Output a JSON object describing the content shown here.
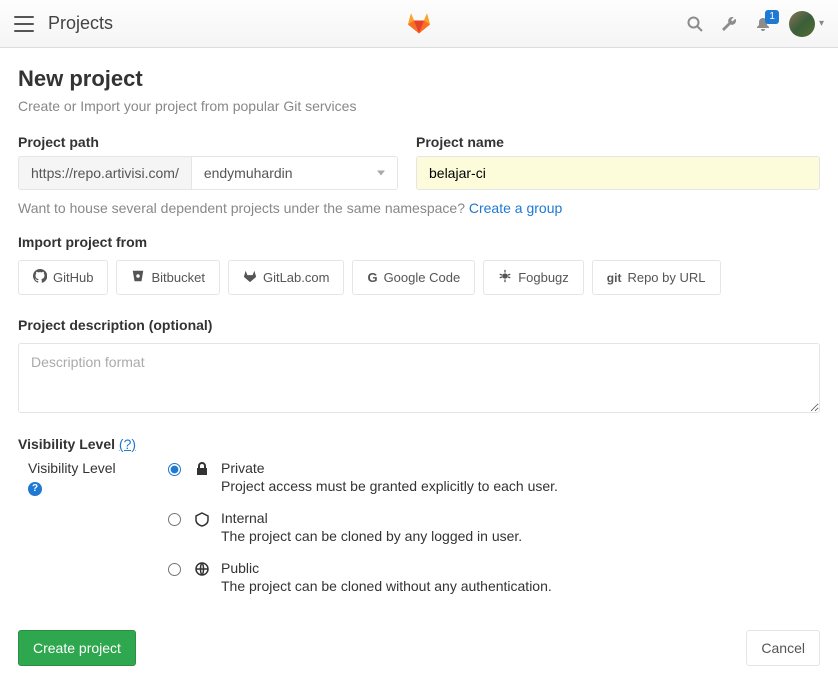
{
  "nav": {
    "title": "Projects",
    "notif_count": "1"
  },
  "page": {
    "title": "New project",
    "subtitle": "Create or Import your project from popular Git services"
  },
  "path": {
    "label": "Project path",
    "prefix": "https://repo.artivisi.com/",
    "namespace": "endymuhardin"
  },
  "name": {
    "label": "Project name",
    "value": "belajar-ci"
  },
  "group_hint": {
    "text": "Want to house several dependent projects under the same namespace? ",
    "link_text": "Create a group"
  },
  "import": {
    "label": "Import project from",
    "sources": [
      {
        "icon": "github",
        "label": "GitHub"
      },
      {
        "icon": "bitbucket",
        "label": "Bitbucket"
      },
      {
        "icon": "gitlab",
        "label": "GitLab.com"
      },
      {
        "icon": "google",
        "label": "Google Code"
      },
      {
        "icon": "fogbugz",
        "label": "Fogbugz"
      },
      {
        "icon": "git",
        "label": "Repo by URL"
      }
    ]
  },
  "description": {
    "label": "Project description (optional)",
    "placeholder": "Description format",
    "value": ""
  },
  "visibility": {
    "header": "Visibility Level",
    "help": "(?)",
    "side_label": "Visibility Level",
    "options": [
      {
        "key": "private",
        "name": "Private",
        "desc": "Project access must be granted explicitly to each user.",
        "selected": true
      },
      {
        "key": "internal",
        "name": "Internal",
        "desc": "The project can be cloned by any logged in user.",
        "selected": false
      },
      {
        "key": "public",
        "name": "Public",
        "desc": "The project can be cloned without any authentication.",
        "selected": false
      }
    ]
  },
  "actions": {
    "create": "Create project",
    "cancel": "Cancel"
  }
}
